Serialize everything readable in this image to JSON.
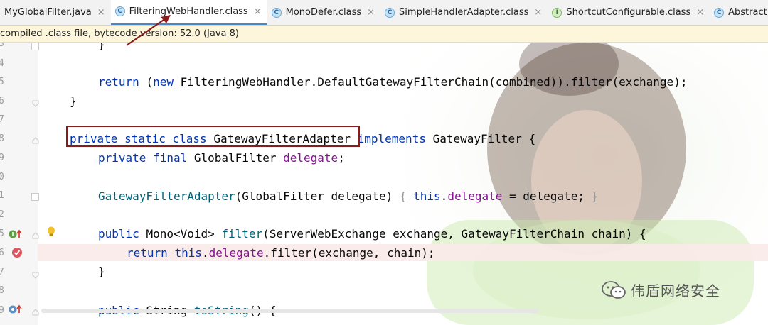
{
  "tabs": [
    {
      "label": "MyGlobalFilter.java",
      "icon": "java-file-icon",
      "active": false
    },
    {
      "label": "FilteringWebHandler.class",
      "icon": "class-icon",
      "active": true
    },
    {
      "label": "MonoDefer.class",
      "icon": "class-icon",
      "active": false
    },
    {
      "label": "SimpleHandlerAdapter.class",
      "icon": "class-icon",
      "active": false
    },
    {
      "label": "ShortcutConfigurable.class",
      "icon": "interface-icon",
      "active": false
    },
    {
      "label": "AbstractHandlerMa",
      "icon": "class-icon",
      "active": false
    }
  ],
  "tab_icon_letters": {
    "class": "C",
    "interface": "I"
  },
  "close_glyph": "×",
  "banner": {
    "text": "compiled .class file, bytecode version: 52.0 (Java 8)"
  },
  "line_numbers": [
    "3",
    "4",
    "5",
    "6",
    "7",
    "8",
    "9",
    "0",
    "1",
    "2",
    "5",
    "6",
    "7",
    "8",
    "9"
  ],
  "code": {
    "l0": "}",
    "l2_return": "return",
    "l2_new": "new",
    "l2_rest": "FilteringWebHandler.DefaultGatewayFilterChain(combined)).filter(exchange);",
    "l2_open": "(",
    "l3": "}",
    "l5_private": "private",
    "l5_static": "static",
    "l5_class": "class",
    "l5_name": "GatewayFilterAdapter",
    "l5_implements": "implements",
    "l5_rest": "GatewayFilter {",
    "l6_private": "private",
    "l6_final": "final",
    "l6_type": "GlobalFilter",
    "l6_field": "delegate",
    "l6_semi": ";",
    "l8_ctor": "GatewayFilterAdapter",
    "l8_params": "(GlobalFilter delegate)",
    "l8_open": "{",
    "l8_this": "this",
    "l8_dot": ".",
    "l8_field": "delegate",
    "l8_rest": " = delegate;",
    "l8_close": "}",
    "l10_public": "public",
    "l10_type": "Mono<Void>",
    "l10_method": "filter",
    "l10_rest": "(ServerWebExchange exchange, GatewayFilterChain chain) {",
    "l11_return": "return",
    "l11_this": "this",
    "l11_dot": ".",
    "l11_field": "delegate",
    "l11_rest": ".filter(exchange, chain);",
    "l12": "}",
    "l14_public": "public",
    "l14_type": "String",
    "l14_method": "toString",
    "l14_rest": "() {"
  },
  "watermark": {
    "text": "伟盾网络安全"
  },
  "colors": {
    "keyword": "#0033b3",
    "field": "#871094",
    "method": "#00627a",
    "annotation_box": "#8b1a1a",
    "active_tab": "#4a86c7"
  }
}
